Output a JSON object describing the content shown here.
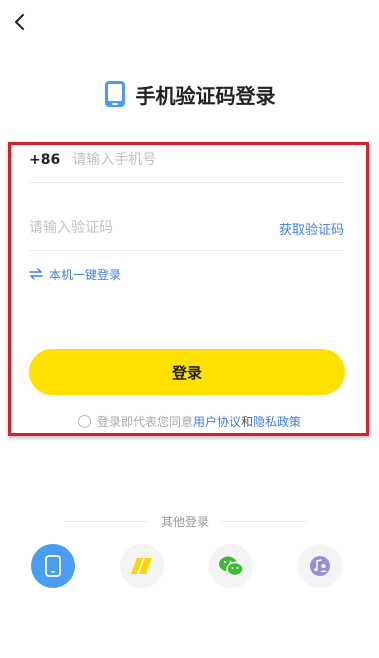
{
  "header": {
    "back_icon": "chevron-left-icon"
  },
  "title": {
    "icon": "phone-icon",
    "text": "手机验证码登录"
  },
  "form": {
    "country_code": "+86",
    "phone_placeholder": "请输入手机号",
    "code_placeholder": "请输入验证码",
    "get_code_label": "获取验证码",
    "one_key_label": "本机一键登录",
    "login_label": "登录"
  },
  "agreement": {
    "prefix": "登录即代表您同意",
    "user_agreement": "用户协议",
    "and": "和",
    "privacy_policy": "隐私政策"
  },
  "other_login": {
    "label": "其他登录",
    "methods": [
      "phone-login",
      "yellow-brand-login",
      "wechat-login",
      "music-account-login"
    ]
  },
  "colors": {
    "accent_yellow": "#ffe100",
    "link_blue": "#3f7ee8",
    "highlight_red": "#d4202a",
    "phone_blue": "#4a9df0",
    "wechat_green": "#3dbb36",
    "purple": "#9b8bd8"
  }
}
